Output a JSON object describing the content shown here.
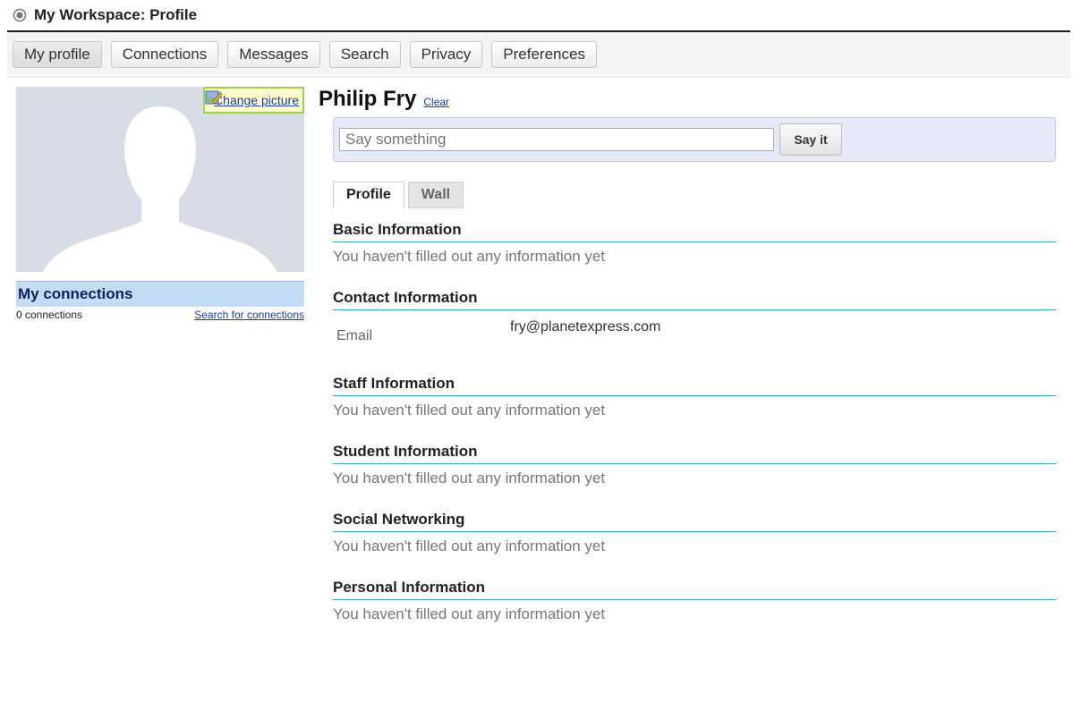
{
  "header": {
    "title": "My Workspace: Profile"
  },
  "nav": {
    "items": [
      {
        "label": "My profile"
      },
      {
        "label": "Connections"
      },
      {
        "label": "Messages"
      },
      {
        "label": "Search"
      },
      {
        "label": "Privacy"
      },
      {
        "label": "Preferences"
      }
    ],
    "active": "My profile"
  },
  "sidebar": {
    "change_picture": "Change picture",
    "connections_title": "My connections",
    "connections_count": "0 connections",
    "search_link": "Search for connections"
  },
  "profile": {
    "name": "Philip Fry",
    "clear_label": "Clear",
    "say_placeholder": "Say something",
    "say_button": "Say it",
    "tabs": [
      {
        "label": "Profile"
      },
      {
        "label": "Wall"
      }
    ],
    "active_tab": "Profile"
  },
  "sections": {
    "basic": {
      "title": "Basic Information",
      "text": "You haven't filled out any information yet"
    },
    "contact": {
      "title": "Contact Information",
      "email_label": "Email",
      "email_value": "fry@planetexpress.com"
    },
    "staff": {
      "title": "Staff Information",
      "text": "You haven't filled out any information yet"
    },
    "student": {
      "title": "Student Information",
      "text": "You haven't filled out any information yet"
    },
    "social": {
      "title": "Social Networking",
      "text": "You haven't filled out any information yet"
    },
    "personal": {
      "title": "Personal Information",
      "text": "You haven't filled out any information yet"
    }
  },
  "colors": {
    "accent_rule": "#3aa4c4",
    "link": "#1a3aa8",
    "connections_header": "#c5dcf7",
    "say_box_bg": "#e6e9f7"
  },
  "icons": {
    "title": "radio-icon",
    "change_picture": "edit-picture-icon",
    "avatar": "avatar-silhouette-icon"
  }
}
